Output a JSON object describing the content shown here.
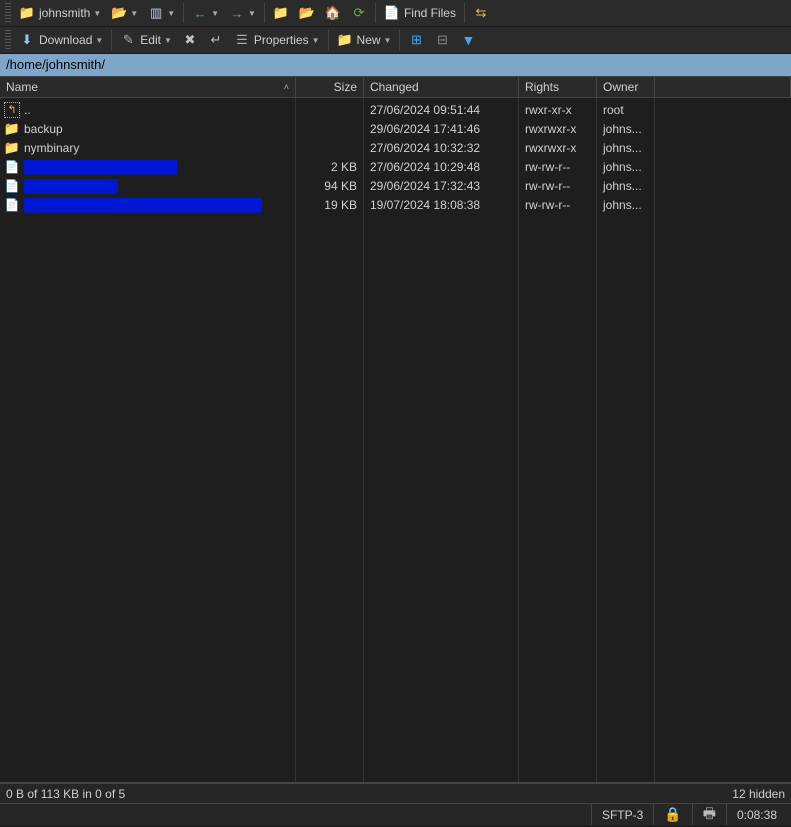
{
  "toolbar1": {
    "session_label": "johnsmith",
    "find_files_label": "Find Files"
  },
  "toolbar2": {
    "download_label": "Download",
    "edit_label": "Edit",
    "properties_label": "Properties",
    "new_label": "New"
  },
  "path": "/home/johnsmith/",
  "columns": {
    "name": "Name",
    "size": "Size",
    "changed": "Changed",
    "rights": "Rights",
    "owner": "Owner"
  },
  "rows": [
    {
      "type": "up",
      "name": "..",
      "size": "",
      "changed": "27/06/2024 09:51:44",
      "rights": "rwxr-xr-x",
      "owner": "root"
    },
    {
      "type": "folder",
      "name": "backup",
      "size": "",
      "changed": "29/06/2024 17:41:46",
      "rights": "rwxrwxr-x",
      "owner": "johns..."
    },
    {
      "type": "folder",
      "name": "nymbinary",
      "size": "",
      "changed": "27/06/2024 10:32:32",
      "rights": "rwxrwxr-x",
      "owner": "johns..."
    },
    {
      "type": "file",
      "name": "██████████████████",
      "redacted": true,
      "size": "2 KB",
      "changed": "27/06/2024 10:29:48",
      "rights": "rw-rw-r--",
      "owner": "johns..."
    },
    {
      "type": "file",
      "name": "███████████",
      "redacted": true,
      "size": "94 KB",
      "changed": "29/06/2024 17:32:43",
      "rights": "rw-rw-r--",
      "owner": "johns..."
    },
    {
      "type": "file",
      "name": "████████████████████████████",
      "redacted": true,
      "size": "19 KB",
      "changed": "19/07/2024 18:08:38",
      "rights": "rw-rw-r--",
      "owner": "johns..."
    }
  ],
  "status": {
    "selection": "0 B of 113 KB in 0 of 5",
    "hidden": "12 hidden",
    "protocol": "SFTP-3",
    "time": "0:08:38"
  }
}
